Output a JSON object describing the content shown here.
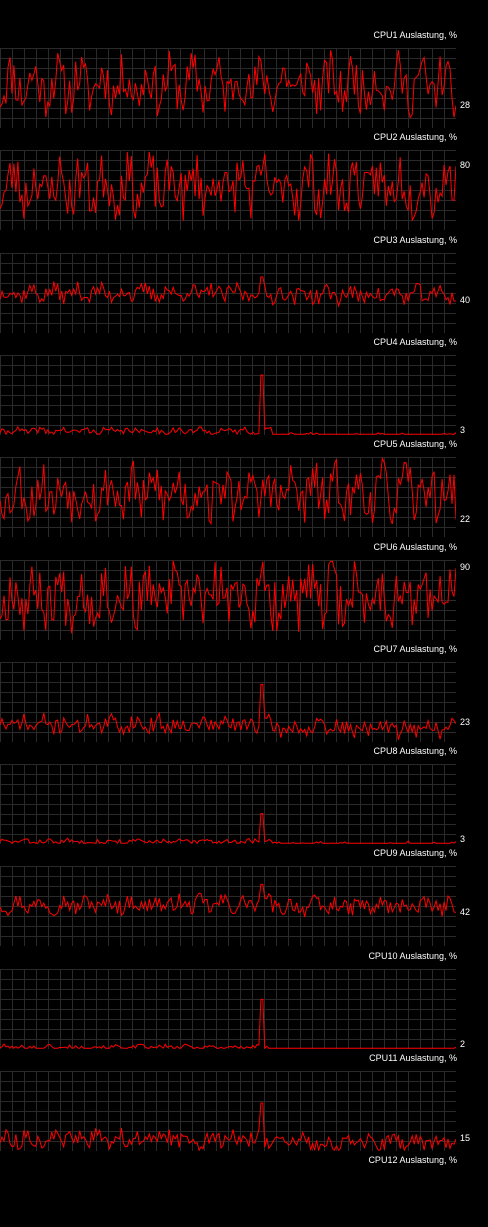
{
  "chart_data": {
    "type": "line",
    "line_color": "#ff0000",
    "grid_color": "#2a2a2a",
    "background": "#000000",
    "ylim": [
      0,
      100
    ],
    "grid": true,
    "panels": [
      {
        "title": "CPU1 Auslastung, %",
        "current": "28",
        "current_value": 28,
        "base": 55,
        "amp": 30,
        "spike": 0,
        "seed": 11
      },
      {
        "title": "CPU2 Auslastung, %",
        "current": "80",
        "current_value": 80,
        "base": 55,
        "amp": 32,
        "spike": 0,
        "seed": 23
      },
      {
        "title": "CPU3 Auslastung, %",
        "current": "40",
        "current_value": 40,
        "base": 50,
        "amp": 10,
        "spike": 20,
        "seed": 37
      },
      {
        "title": "CPU4 Auslastung, %",
        "current": "3",
        "current_value": 3,
        "base": 5,
        "amp": 4,
        "spike": 70,
        "seed": 41
      },
      {
        "title": "CPU5 Auslastung, %",
        "current": "22",
        "current_value": 22,
        "base": 55,
        "amp": 30,
        "spike": 0,
        "seed": 53
      },
      {
        "title": "CPU6 Auslastung, %",
        "current": "90",
        "current_value": 90,
        "base": 55,
        "amp": 33,
        "spike": 0,
        "seed": 67
      },
      {
        "title": "CPU7 Auslastung, %",
        "current": "23",
        "current_value": 23,
        "base": 22,
        "amp": 10,
        "spike": 50,
        "seed": 71
      },
      {
        "title": "CPU8 Auslastung, %",
        "current": "3",
        "current_value": 3,
        "base": 3,
        "amp": 3,
        "spike": 35,
        "seed": 83
      },
      {
        "title": "CPU9 Auslastung, %",
        "current": "42",
        "current_value": 42,
        "base": 52,
        "amp": 10,
        "spike": 25,
        "seed": 97
      },
      {
        "title": "CPU10 Auslastung, %",
        "current": "2",
        "current_value": 2,
        "base": 2,
        "amp": 3,
        "spike": 60,
        "seed": 101
      },
      {
        "title": "CPU11 Auslastung, %",
        "current": "15",
        "current_value": 15,
        "base": 15,
        "amp": 10,
        "spike": 45,
        "seed": 113
      },
      {
        "title": "CPU12 Auslastung, %",
        "current": "",
        "current_value": null,
        "base": 0,
        "amp": 0,
        "spike": 0,
        "seed": 127
      }
    ]
  }
}
